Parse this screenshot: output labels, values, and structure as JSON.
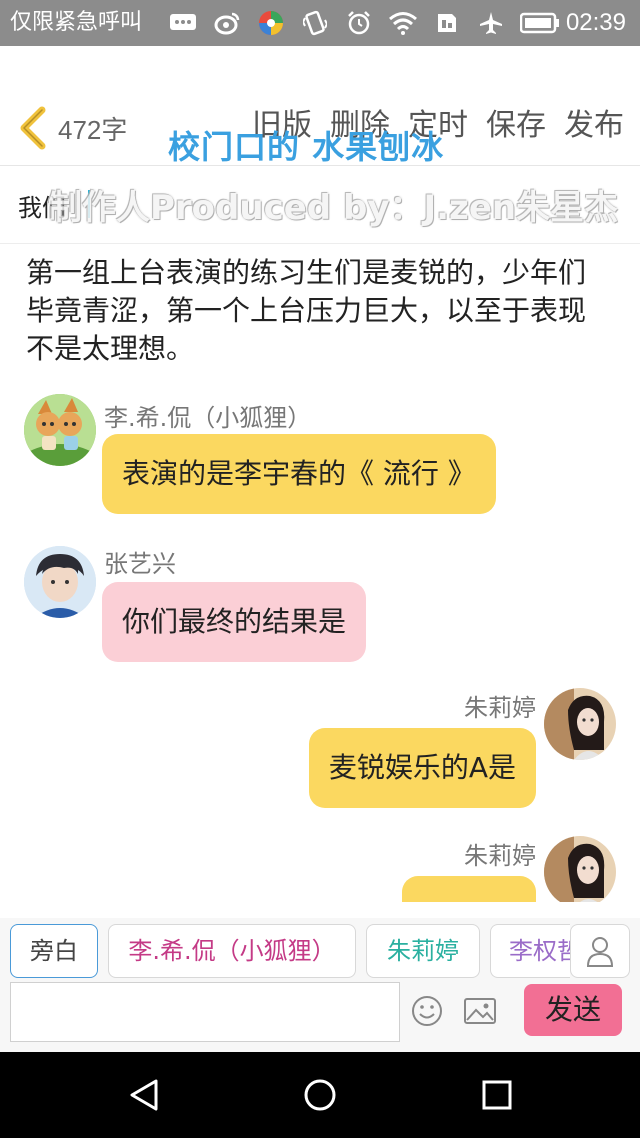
{
  "status_bar": {
    "carrier": "仅限紧急呼叫",
    "time": "02:39",
    "icons": [
      "message-icon",
      "weibo-icon",
      "browser-icon",
      "vibrate-icon",
      "alarm-icon",
      "wifi-icon",
      "sim-icon",
      "airplane-icon",
      "battery-icon"
    ]
  },
  "toolbar": {
    "word_count": "472字",
    "actions": [
      "旧版",
      "删除",
      "定时",
      "保存",
      "发布"
    ]
  },
  "title": "我们",
  "watermark": {
    "title": "校门口的 水果刨冰",
    "producer": "制作人Produced by：J.zen朱星杰"
  },
  "narration": "第一组上台表演的练习生们是麦锐的，少年们毕竟青涩，第一个上台压力巨大，以至于表现不是太理想。",
  "messages": [
    {
      "name": "李.希.侃（小狐狸）",
      "text": "表演的是李宇春的《 流行 》",
      "side": "left",
      "color": "#fbd860"
    },
    {
      "name": "张艺兴",
      "text": "你们最终的结果是",
      "side": "left",
      "color": "#fbcfd6"
    },
    {
      "name": "朱莉婷",
      "text": "麦锐娱乐的A是",
      "side": "right",
      "color": "#fbd860"
    },
    {
      "name": "朱莉婷",
      "text": "",
      "side": "right",
      "color": "#fbd860"
    }
  ],
  "role_chips": [
    {
      "label": "旁白",
      "color": "#444444"
    },
    {
      "label": "李.希.侃（小狐狸）",
      "color": "#c43a86"
    },
    {
      "label": "朱莉婷",
      "color": "#2ab0a0"
    },
    {
      "label": "李权哲",
      "color": "#9a6cc8"
    }
  ],
  "input": {
    "placeholder": "",
    "send_label": "发送"
  },
  "colors": {
    "accent_pink": "#f26f94",
    "bubble_yellow": "#fbd860",
    "bubble_pink": "#fbcfd6",
    "status_bar": "#8c8c8c"
  }
}
